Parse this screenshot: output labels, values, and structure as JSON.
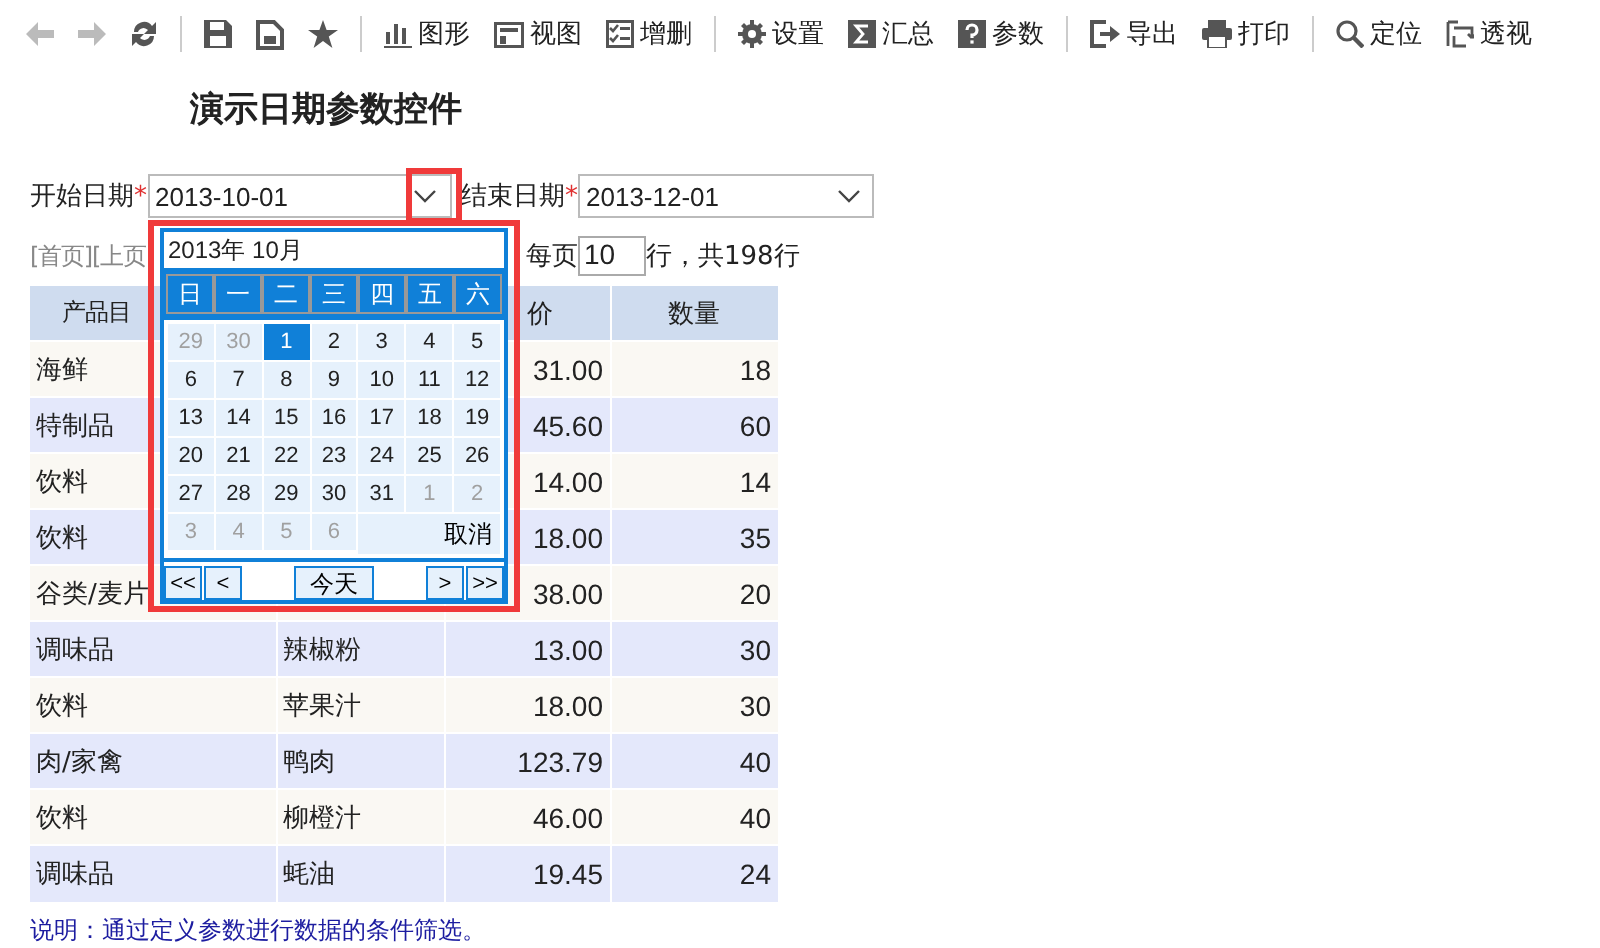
{
  "toolbar": {
    "groups": [
      [
        {
          "kind": "back",
          "disabled": true
        },
        {
          "kind": "forward",
          "disabled": true
        },
        {
          "kind": "refresh",
          "disabled": false
        }
      ],
      [
        {
          "kind": "save",
          "disabled": false
        },
        {
          "kind": "save-as",
          "disabled": false
        },
        {
          "kind": "star",
          "disabled": false
        }
      ],
      [
        {
          "kind": "chart",
          "label": "图形",
          "disabled": false
        },
        {
          "kind": "view",
          "label": "视图",
          "disabled": false
        },
        {
          "kind": "edit",
          "label": "增删",
          "disabled": false
        }
      ],
      [
        {
          "kind": "gear",
          "label": "设置",
          "disabled": false
        },
        {
          "kind": "sigma",
          "label": "汇总",
          "disabled": false
        },
        {
          "kind": "question",
          "label": "参数",
          "disabled": false
        }
      ],
      [
        {
          "kind": "export",
          "label": "导出",
          "disabled": false
        },
        {
          "kind": "print",
          "label": "打印",
          "disabled": false
        }
      ],
      [
        {
          "kind": "search",
          "label": "定位",
          "disabled": false
        },
        {
          "kind": "pivot",
          "label": "透视",
          "disabled": false
        }
      ]
    ]
  },
  "title": "演示日期参数控件",
  "params": [
    {
      "label": "开始日期",
      "required_mark": "*",
      "value": "2013-10-01",
      "highlighted": true
    },
    {
      "label": "结束日期",
      "required_mark": "*",
      "value": "2013-12-01",
      "highlighted": false
    }
  ],
  "pager": {
    "links": "[首页][上页",
    "per_page_label": "每页",
    "per_page_value": "10",
    "total": "行，共198行"
  },
  "table": {
    "columns": [
      "产品目",
      "价",
      "数量"
    ],
    "rows": [
      {
        "category": "海鲜",
        "price": "31.00",
        "qty": "18"
      },
      {
        "category": "特制品",
        "price": "45.60",
        "qty": "60"
      },
      {
        "category": "饮料",
        "price": "14.00",
        "qty": "14"
      },
      {
        "category": "饮料",
        "price": "18.00",
        "qty": "35"
      },
      {
        "category": "谷类/麦片",
        "price": "38.00",
        "qty": "20"
      },
      {
        "category": "调味品",
        "product": "辣椒粉",
        "price": "13.00",
        "qty": "30"
      },
      {
        "category": "饮料",
        "product": "苹果汁",
        "price": "18.00",
        "qty": "30"
      },
      {
        "category": "肉/家禽",
        "product": "鸭肉",
        "price": "123.79",
        "qty": "40"
      },
      {
        "category": "饮料",
        "product": "柳橙汁",
        "price": "46.00",
        "qty": "40"
      },
      {
        "category": "调味品",
        "product": "蚝油",
        "price": "19.45",
        "qty": "24"
      }
    ]
  },
  "note": "说明：通过定义参数进行数据的条件筛选。",
  "calendar": {
    "header": "2013年 10月",
    "weekdays": [
      "日",
      "一",
      "二",
      "三",
      "四",
      "五",
      "六"
    ],
    "days": [
      {
        "label": "29",
        "outside": true,
        "selected": false
      },
      {
        "label": "30",
        "outside": true,
        "selected": false
      },
      {
        "label": "1",
        "outside": false,
        "selected": true
      },
      {
        "label": "2",
        "outside": false,
        "selected": false
      },
      {
        "label": "3",
        "outside": false,
        "selected": false
      },
      {
        "label": "4",
        "outside": false,
        "selected": false
      },
      {
        "label": "5",
        "outside": false,
        "selected": false
      },
      {
        "label": "6",
        "outside": false,
        "selected": false
      },
      {
        "label": "7",
        "outside": false,
        "selected": false
      },
      {
        "label": "8",
        "outside": false,
        "selected": false
      },
      {
        "label": "9",
        "outside": false,
        "selected": false
      },
      {
        "label": "10",
        "outside": false,
        "selected": false
      },
      {
        "label": "11",
        "outside": false,
        "selected": false
      },
      {
        "label": "12",
        "outside": false,
        "selected": false
      },
      {
        "label": "13",
        "outside": false,
        "selected": false
      },
      {
        "label": "14",
        "outside": false,
        "selected": false
      },
      {
        "label": "15",
        "outside": false,
        "selected": false
      },
      {
        "label": "16",
        "outside": false,
        "selected": false
      },
      {
        "label": "17",
        "outside": false,
        "selected": false
      },
      {
        "label": "18",
        "outside": false,
        "selected": false
      },
      {
        "label": "19",
        "outside": false,
        "selected": false
      },
      {
        "label": "20",
        "outside": false,
        "selected": false
      },
      {
        "label": "21",
        "outside": false,
        "selected": false
      },
      {
        "label": "22",
        "outside": false,
        "selected": false
      },
      {
        "label": "23",
        "outside": false,
        "selected": false
      },
      {
        "label": "24",
        "outside": false,
        "selected": false
      },
      {
        "label": "25",
        "outside": false,
        "selected": false
      },
      {
        "label": "26",
        "outside": false,
        "selected": false
      },
      {
        "label": "27",
        "outside": false,
        "selected": false
      },
      {
        "label": "28",
        "outside": false,
        "selected": false
      },
      {
        "label": "29",
        "outside": false,
        "selected": false
      },
      {
        "label": "30",
        "outside": false,
        "selected": false
      },
      {
        "label": "31",
        "outside": false,
        "selected": false
      },
      {
        "label": "1",
        "outside": true,
        "selected": false
      },
      {
        "label": "2",
        "outside": true,
        "selected": false
      },
      {
        "label": "3",
        "outside": true,
        "selected": false
      },
      {
        "label": "4",
        "outside": true,
        "selected": false
      },
      {
        "label": "5",
        "outside": true,
        "selected": false
      },
      {
        "label": "6",
        "outside": true,
        "selected": false
      }
    ],
    "cancel": "取消",
    "nav": {
      "first": "<<",
      "prev": "<",
      "today": "今天",
      "next": ">",
      "last": ">>"
    }
  }
}
